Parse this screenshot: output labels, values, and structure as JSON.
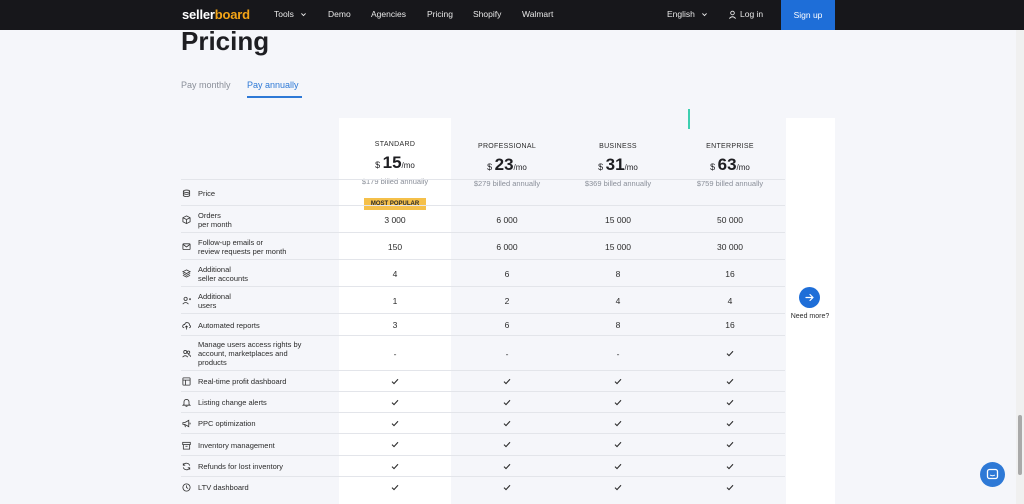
{
  "nav": {
    "logo_main": "seller",
    "logo_accent": "board",
    "links": [
      "Tools",
      "Demo",
      "Agencies",
      "Pricing",
      "Shopify",
      "Walmart"
    ],
    "language": "English",
    "login": "Log in",
    "signup": "Sign up"
  },
  "page": {
    "title": "Pricing",
    "billing_monthly": "Pay monthly",
    "billing_annually": "Pay annually",
    "most_popular": "MOST POPULAR",
    "need_more": "Need more?"
  },
  "plans": [
    {
      "name": "STANDARD",
      "currency": "$",
      "amount": "15",
      "per": "/mo",
      "billed": "$179 billed annually"
    },
    {
      "name": "PROFESSIONAL",
      "currency": "$",
      "amount": "23",
      "per": "/mo",
      "billed": "$279 billed annually"
    },
    {
      "name": "BUSINESS",
      "currency": "$",
      "amount": "31",
      "per": "/mo",
      "billed": "$369 billed annually"
    },
    {
      "name": "ENTERPRISE",
      "currency": "$",
      "amount": "63",
      "per": "/mo",
      "billed": "$759 billed annually"
    }
  ],
  "features": [
    {
      "label": "Price",
      "icon": "price-icon",
      "values": [
        "",
        "",
        "",
        ""
      ]
    },
    {
      "label": "Orders\nper month",
      "icon": "box-icon",
      "values": [
        "3 000",
        "6 000",
        "15 000",
        "50 000"
      ]
    },
    {
      "label": "Follow-up emails or\nreview requests per month",
      "icon": "mail-icon",
      "values": [
        "150",
        "6 000",
        "15 000",
        "30 000"
      ]
    },
    {
      "label": "Additional\nseller accounts",
      "icon": "layers-icon",
      "values": [
        "4",
        "6",
        "8",
        "16"
      ]
    },
    {
      "label": "Additional\nusers",
      "icon": "add-user-icon",
      "values": [
        "1",
        "2",
        "4",
        "4"
      ]
    },
    {
      "label": "Automated reports",
      "icon": "cloud-upload-icon",
      "values": [
        "3",
        "6",
        "8",
        "16"
      ]
    },
    {
      "label": "Manage users access rights by\naccount, marketplaces and\nproducts",
      "icon": "users-icon",
      "values": [
        "-",
        "-",
        "-",
        "check"
      ]
    },
    {
      "label": "Real-time profit dashboard",
      "icon": "dashboard-icon",
      "values": [
        "check",
        "check",
        "check",
        "check"
      ]
    },
    {
      "label": "Listing change alerts",
      "icon": "bell-icon",
      "values": [
        "check",
        "check",
        "check",
        "check"
      ]
    },
    {
      "label": "PPC optimization",
      "icon": "megaphone-icon",
      "values": [
        "check",
        "check",
        "check",
        "check"
      ]
    },
    {
      "label": "Inventory management",
      "icon": "archive-icon",
      "values": [
        "check",
        "check",
        "check",
        "check"
      ]
    },
    {
      "label": "Refunds for lost inventory",
      "icon": "refresh-icon",
      "values": [
        "check",
        "check",
        "check",
        "check"
      ]
    },
    {
      "label": "LTV dashboard",
      "icon": "clock-icon",
      "values": [
        "check",
        "check",
        "check",
        "check"
      ]
    }
  ],
  "colors": {
    "nav_bg": "#17171b",
    "brand_accent": "#f3a417",
    "primary": "#1e6ed8",
    "badge": "#f5c04a",
    "teal_accent": "#3ecfb0"
  }
}
